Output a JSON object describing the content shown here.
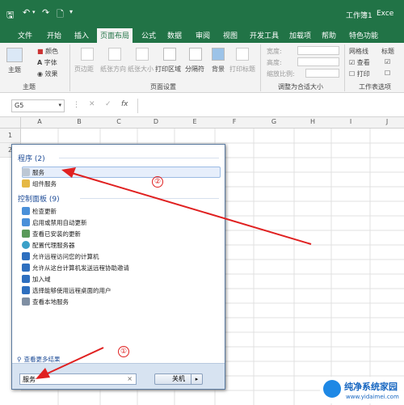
{
  "titlebar": {
    "doc_title": "工作簿1",
    "app": "Exce"
  },
  "tabs": [
    "文件",
    "开始",
    "插入",
    "页面布局",
    "公式",
    "数据",
    "审阅",
    "视图",
    "开发工具",
    "加载项",
    "帮助",
    "特色功能"
  ],
  "ribbon": {
    "theme_group": {
      "colors": "颜色",
      "fonts": "字体",
      "effects": "效果",
      "themes": "主题",
      "label": "主题"
    },
    "page_setup": {
      "margins": "页边距",
      "orientation": "纸张方向",
      "size": "纸张大小",
      "print_area": "打印区域",
      "breaks": "分隔符",
      "background": "背景",
      "print_titles": "打印标题",
      "label": "页面设置"
    },
    "scale": {
      "width": "宽度:",
      "height": "高度:",
      "scale": "缩放比例:",
      "label": "调整为合适大小"
    },
    "sheet_opts": {
      "gridlines": "网格线",
      "view": "查看",
      "print": "打印",
      "headings": "标题",
      "label": "工作表选项"
    }
  },
  "formulabar": {
    "namebox": "G5",
    "fx": "fx"
  },
  "columns": [
    "A",
    "B",
    "C",
    "D",
    "E",
    "F",
    "G",
    "H",
    "I",
    "J"
  ],
  "rows": [
    "1",
    "2"
  ],
  "startmenu": {
    "programs_header": "程序 (2)",
    "programs": [
      "服务",
      "组件服务"
    ],
    "control_header": "控制面板 (9)",
    "control_items": [
      "检查更新",
      "启用或禁用自动更新",
      "查看已安装的更新",
      "配置代理服务器",
      "允许远程访问您的计算机",
      "允许从这台计算机发送远程协助邀请",
      "加入域",
      "选择能够使用远程桌面的用户",
      "查看本地服务"
    ],
    "see_more": "查看更多结果",
    "search_value": "服务",
    "shutdown": "关机"
  },
  "annotations": [
    "①",
    "②"
  ],
  "watermark": {
    "name": "纯净系统家园",
    "url": "www.yidaimei.com"
  }
}
